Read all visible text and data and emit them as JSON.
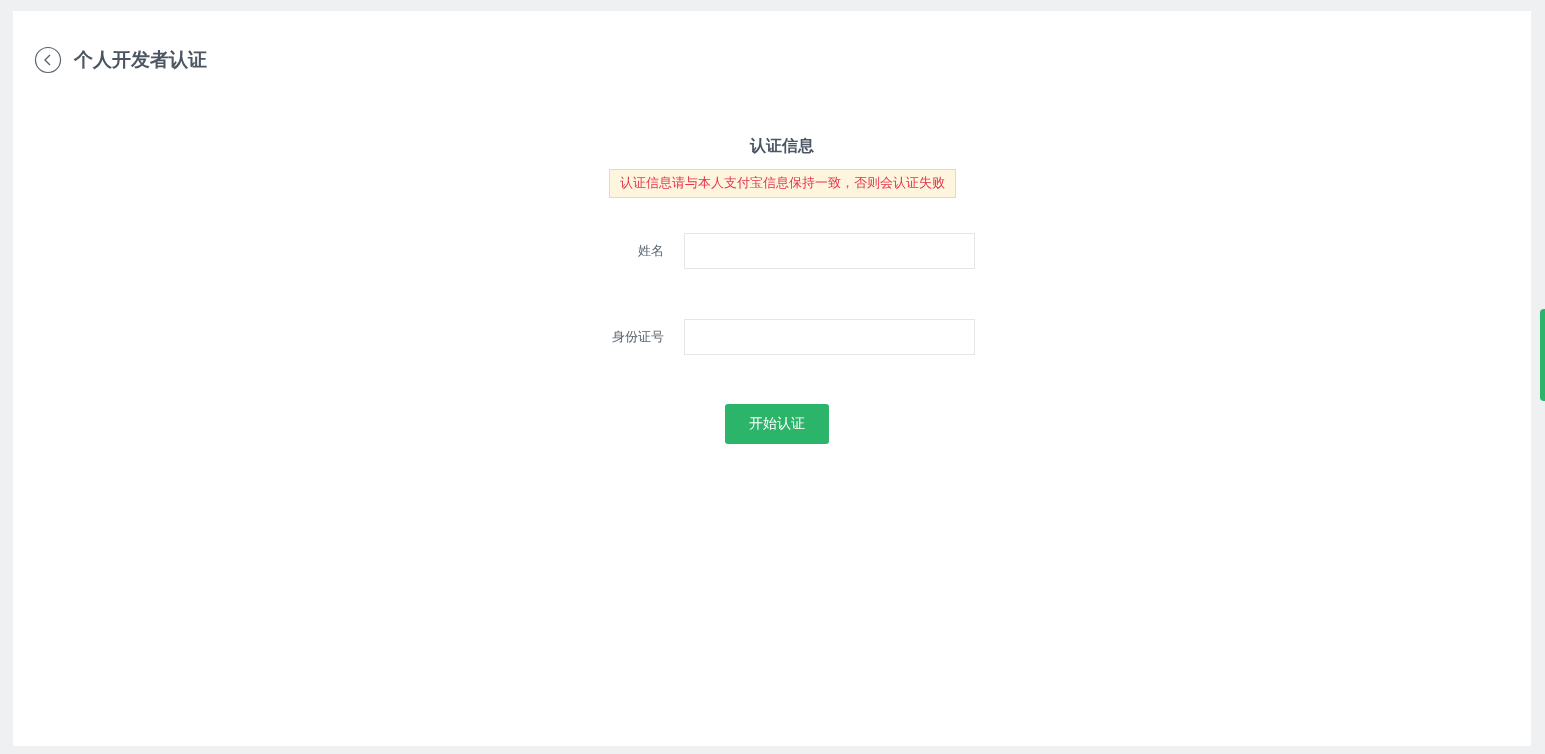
{
  "header": {
    "title": "个人开发者认证"
  },
  "form": {
    "title": "认证信息",
    "notice": "认证信息请与本人支付宝信息保持一致，否则会认证失败",
    "fields": [
      {
        "label": "姓名"
      },
      {
        "label": "身份证号"
      }
    ],
    "submit": "开始认证"
  }
}
